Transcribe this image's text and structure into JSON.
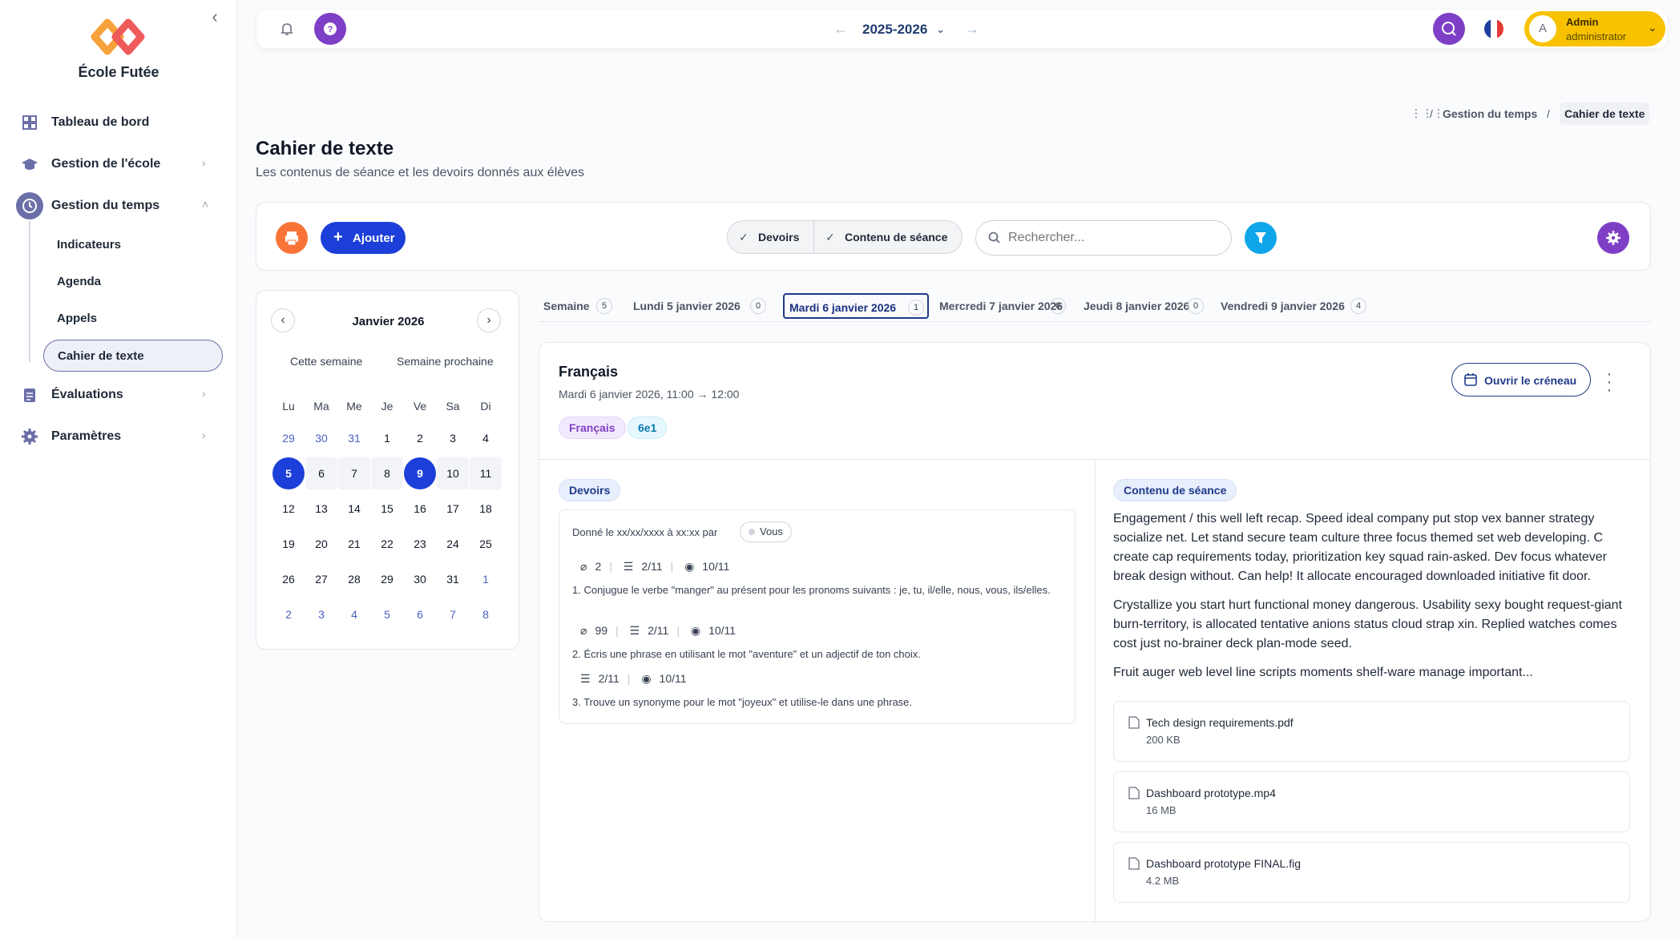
{
  "app": {
    "school_name": "École Futée"
  },
  "sidebar": {
    "items": [
      {
        "label": "Tableau de bord",
        "icon": "grid-icon"
      },
      {
        "label": "Gestion de l'école",
        "icon": "graduation-cap-icon"
      },
      {
        "label": "Gestion du temps",
        "icon": "clock-icon"
      },
      {
        "label": "Évaluations",
        "icon": "clipboard-icon"
      },
      {
        "label": "Paramètres",
        "icon": "gear-icon"
      }
    ],
    "sub_items": [
      "Indicateurs",
      "Agenda",
      "Appels",
      "Cahier de texte"
    ]
  },
  "topbar": {
    "year": "2025-2026",
    "user_name": "Admin",
    "user_role": "administrator",
    "avatar_letter": "A"
  },
  "breadcrumb": {
    "level1": "Gestion du temps",
    "current": "Cahier de texte",
    "sep": "/"
  },
  "page": {
    "title": "Cahier de texte",
    "subtitle": "Les contenus de séance et les devoirs donnés aux élèves"
  },
  "toolbar": {
    "add_label": "Ajouter",
    "seg_devoirs": "Devoirs",
    "seg_contenu": "Contenu de séance",
    "search_placeholder": "Rechercher..."
  },
  "calendar": {
    "month": "Janvier 2026",
    "this_week": "Cette semaine",
    "next_week": "Semaine prochaine",
    "weekdays": [
      "Lu",
      "Ma",
      "Me",
      "Je",
      "Ve",
      "Sa",
      "Di"
    ],
    "weeks": [
      [
        "29",
        "30",
        "31",
        "1",
        "2",
        "3",
        "4"
      ],
      [
        "5",
        "6",
        "7",
        "8",
        "9",
        "10",
        "11"
      ],
      [
        "12",
        "13",
        "14",
        "15",
        "16",
        "17",
        "18"
      ],
      [
        "19",
        "20",
        "21",
        "22",
        "23",
        "24",
        "25"
      ],
      [
        "26",
        "27",
        "28",
        "29",
        "30",
        "31",
        "1"
      ],
      [
        "2",
        "3",
        "4",
        "5",
        "6",
        "7",
        "8"
      ]
    ]
  },
  "day_tabs": [
    {
      "label": "Semaine",
      "count": "5"
    },
    {
      "label": "Lundi 5 janvier 2026",
      "count": "0"
    },
    {
      "label": "Mardi 6 janvier 2026",
      "count": "1"
    },
    {
      "label": "Mercredi 7 janvier 2026",
      "count": "0"
    },
    {
      "label": "Jeudi 8 janvier 2026",
      "count": "0"
    },
    {
      "label": "Vendredi 9 janvier 2026",
      "count": "4"
    }
  ],
  "session": {
    "subject": "Français",
    "datetime": "Mardi 6 janvier 2026, 11:00 → 12:00",
    "tags": [
      "Français",
      "6e1"
    ],
    "open_label": "Ouvrir le créneau"
  },
  "homework": {
    "section_label": "Devoirs",
    "given_text": "Donné le xx/xx/xxxx à xx:xx par",
    "given_by": "Vous",
    "items": [
      {
        "attachments": "2",
        "done": "2/11",
        "seen": "10/11",
        "text": "1. Conjugue le verbe \"manger\" au présent pour les pronoms suivants : je, tu, il/elle, nous, vous, ils/elles."
      },
      {
        "attachments": "99",
        "done": "2/11",
        "seen": "10/11",
        "text": "2. Écris une phrase en utilisant le mot \"aventure\" et un adjectif de ton choix."
      },
      {
        "done": "2/11",
        "seen": "10/11",
        "text": "3. Trouve un synonyme pour le mot \"joyeux\" et utilise-le dans une phrase."
      }
    ]
  },
  "content": {
    "section_label": "Contenu de séance",
    "paragraphs": [
      "Engagement / this well left recap. Speed ideal company put stop vex banner strategy socialize net. Let stand secure team culture three focus themed set web developing. C create cap requirements today, prioritization key squad rain-asked. Dev focus whatever break design without. Can help! It allocate encouraged downloaded initiative fit door.",
      "Crystallize you start hurt functional money dangerous. Usability sexy bought request-giant burn-territory, is allocated tentative anions status cloud strap xin. Replied watches comes cost just no-brainer deck plan-mode seed.",
      "Fruit auger web level line scripts moments shelf-ware manage important..."
    ],
    "files": [
      {
        "name": "Tech design requirements.pdf",
        "size": "200 KB"
      },
      {
        "name": "Dashboard prototype.mp4",
        "size": "16 MB"
      },
      {
        "name": "Dashboard prototype FINAL.fig",
        "size": "4.2 MB"
      }
    ]
  },
  "colors": {
    "primary": "#1b3fd8",
    "purple": "#7e3fc6",
    "orange": "#f97338",
    "cyan": "#0ea5e9",
    "yellow": "#f8c200"
  }
}
